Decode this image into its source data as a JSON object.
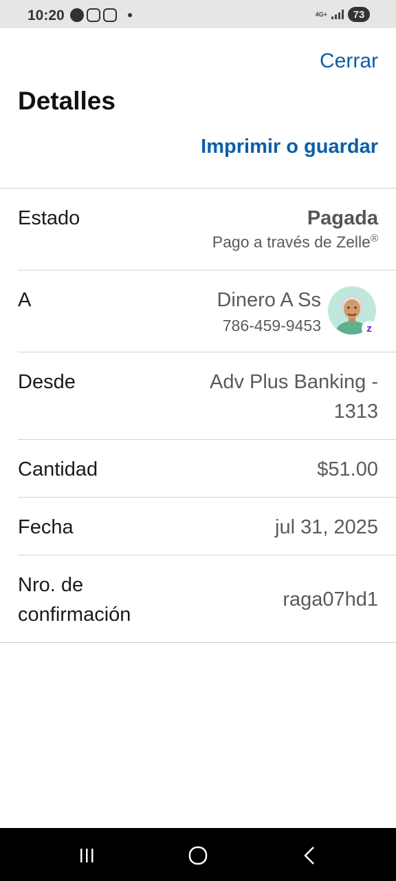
{
  "status_bar": {
    "time": "10:20",
    "network": "4G+",
    "battery": "73"
  },
  "header": {
    "close_label": "Cerrar",
    "title": "Detalles",
    "print_label": "Imprimir o guardar"
  },
  "details": {
    "estado": {
      "label": "Estado",
      "value": "Pagada",
      "sub": "Pago a través de Zelle",
      "sub_mark": "®"
    },
    "a": {
      "label": "A",
      "name": "Dinero A Ss",
      "phone": "786-459-9453"
    },
    "desde": {
      "label": "Desde",
      "value_line1": "Adv Plus Banking -",
      "value_line2": "1313"
    },
    "cantidad": {
      "label": "Cantidad",
      "value": "$51.00"
    },
    "fecha": {
      "label": "Fecha",
      "value": "jul 31, 2025"
    },
    "confirmacion": {
      "label_line1": "Nro. de",
      "label_line2": "confirmación",
      "value": "raga07hd1"
    }
  },
  "colors": {
    "link": "#0b5ea8",
    "zelle": "#6d1ed4"
  }
}
